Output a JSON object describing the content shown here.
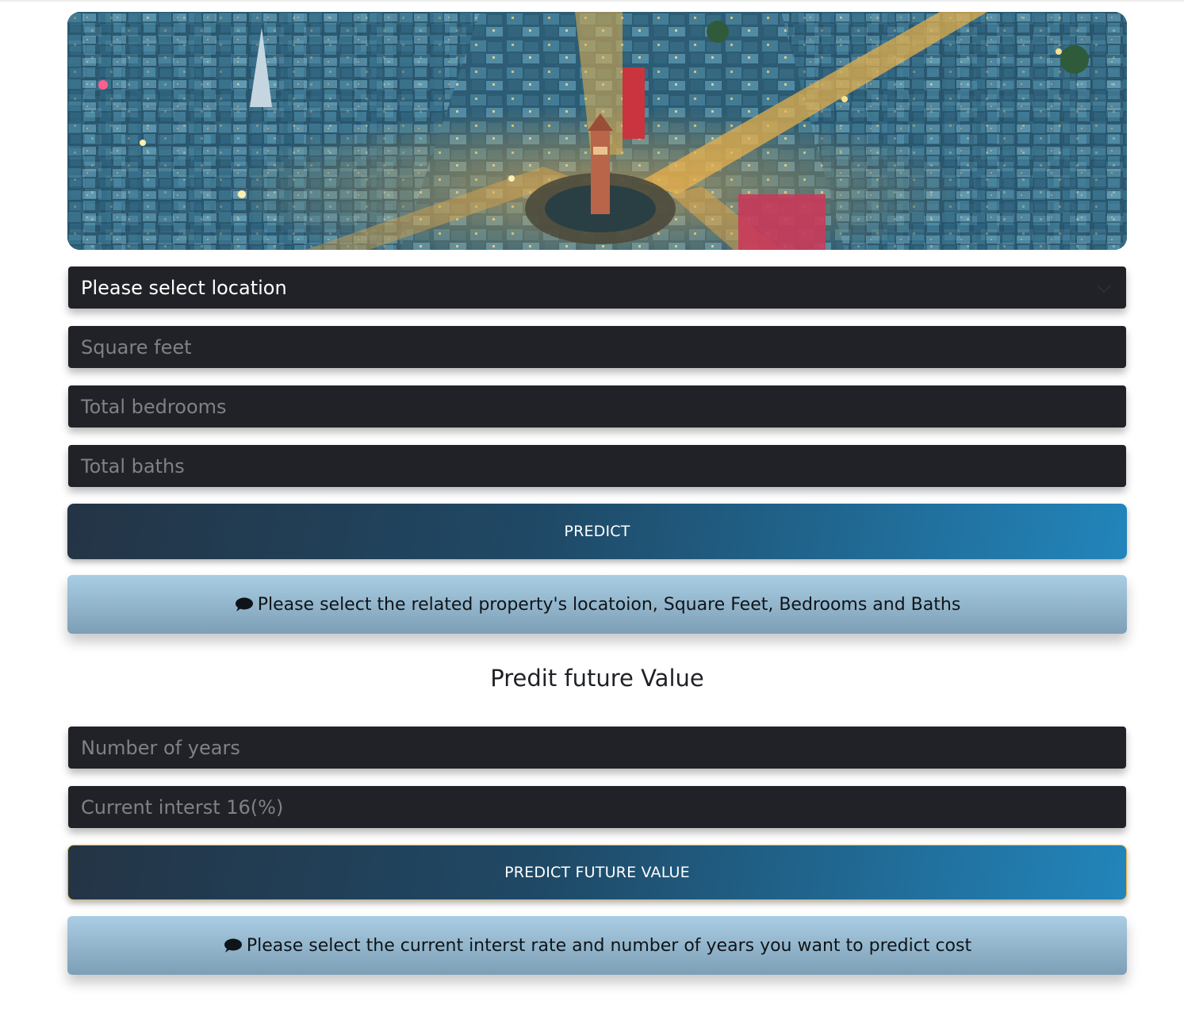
{
  "hero": {
    "image": "aerial-city-clock-tower"
  },
  "form": {
    "location_select": {
      "value": "Please select location"
    },
    "square_feet": {
      "placeholder": "Square feet"
    },
    "bedrooms": {
      "placeholder": "Total bedrooms"
    },
    "baths": {
      "placeholder": "Total baths"
    },
    "predict_button": "PREDICT",
    "predict_message": "Please select the related property's locatoion, Square Feet, Bedrooms and Baths"
  },
  "future": {
    "heading": "Predit future Value",
    "years": {
      "placeholder": "Number of years"
    },
    "interest": {
      "placeholder": "Current interst 16(%)"
    },
    "predict_button": "PREDICT FUTURE VALUE",
    "predict_message": "Please select the current interst rate and number of years you want to predict cost"
  },
  "icons": {
    "message": "comment-icon",
    "dropdown": "chevron-down-icon"
  },
  "colors": {
    "input_bg": "#212228",
    "button_gradient_start": "#243445",
    "button_gradient_end": "#2285bb",
    "alert_top": "#a9cde3",
    "alert_bottom": "#7d9fb6",
    "focus_outline": "#e8b84a"
  }
}
